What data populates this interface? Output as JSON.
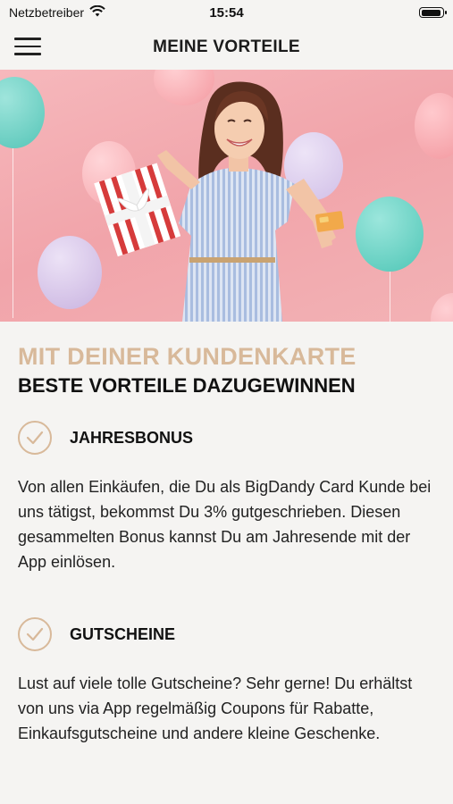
{
  "status_bar": {
    "carrier": "Netzbetreiber",
    "time": "15:54"
  },
  "nav": {
    "title": "MEINE VORTEILE",
    "menu_icon": "hamburger-menu-icon"
  },
  "hero": {
    "description_colors": {
      "background": "#f3aeb3",
      "balloon_teal": "#6fd3c6",
      "balloon_lilac": "#d8c5ea",
      "balloon_pink": "#f7a7ad"
    }
  },
  "intro": {
    "accent_headline": "MIT DEINER KUNDENKARTE",
    "headline": "BESTE VORTEILE DAZUGEWINNEN"
  },
  "benefits": [
    {
      "icon": "check-circle-icon",
      "title": "JAHRESBONUS",
      "text": "Von allen Einkäufen, die Du als BigDandy Card Kunde bei uns tätigst, bekommst Du 3% gutgeschrieben. Diesen gesammelten Bonus kannst Du am Jahresende mit der App einlösen."
    },
    {
      "icon": "check-circle-icon",
      "title": "GUTSCHEINE",
      "text": "Lust auf viele tolle Gutscheine? Sehr gerne! Du erhältst von uns via App regelmäßig Coupons für Rabatte, Einkaufsgutscheine und andere kleine Geschenke."
    }
  ],
  "colors": {
    "accent": "#d8b99a",
    "background": "#f5f4f2",
    "text": "#1b1b1b"
  }
}
